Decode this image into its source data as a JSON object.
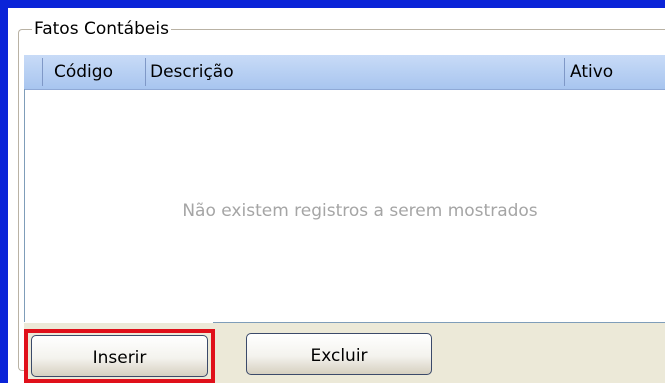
{
  "group": {
    "title": "Fatos Contábeis"
  },
  "grid": {
    "columns": [
      "Código",
      "Descrição",
      "Ativo"
    ],
    "rows": [],
    "empty_message": "Não existem registros a serem mostrados"
  },
  "actions": {
    "insert_label": "Inserir",
    "delete_label": "Excluir"
  },
  "colors": {
    "frame_border": "#0a24d8",
    "highlight": "#e0101a",
    "header_bg": "#bcd3f3"
  }
}
